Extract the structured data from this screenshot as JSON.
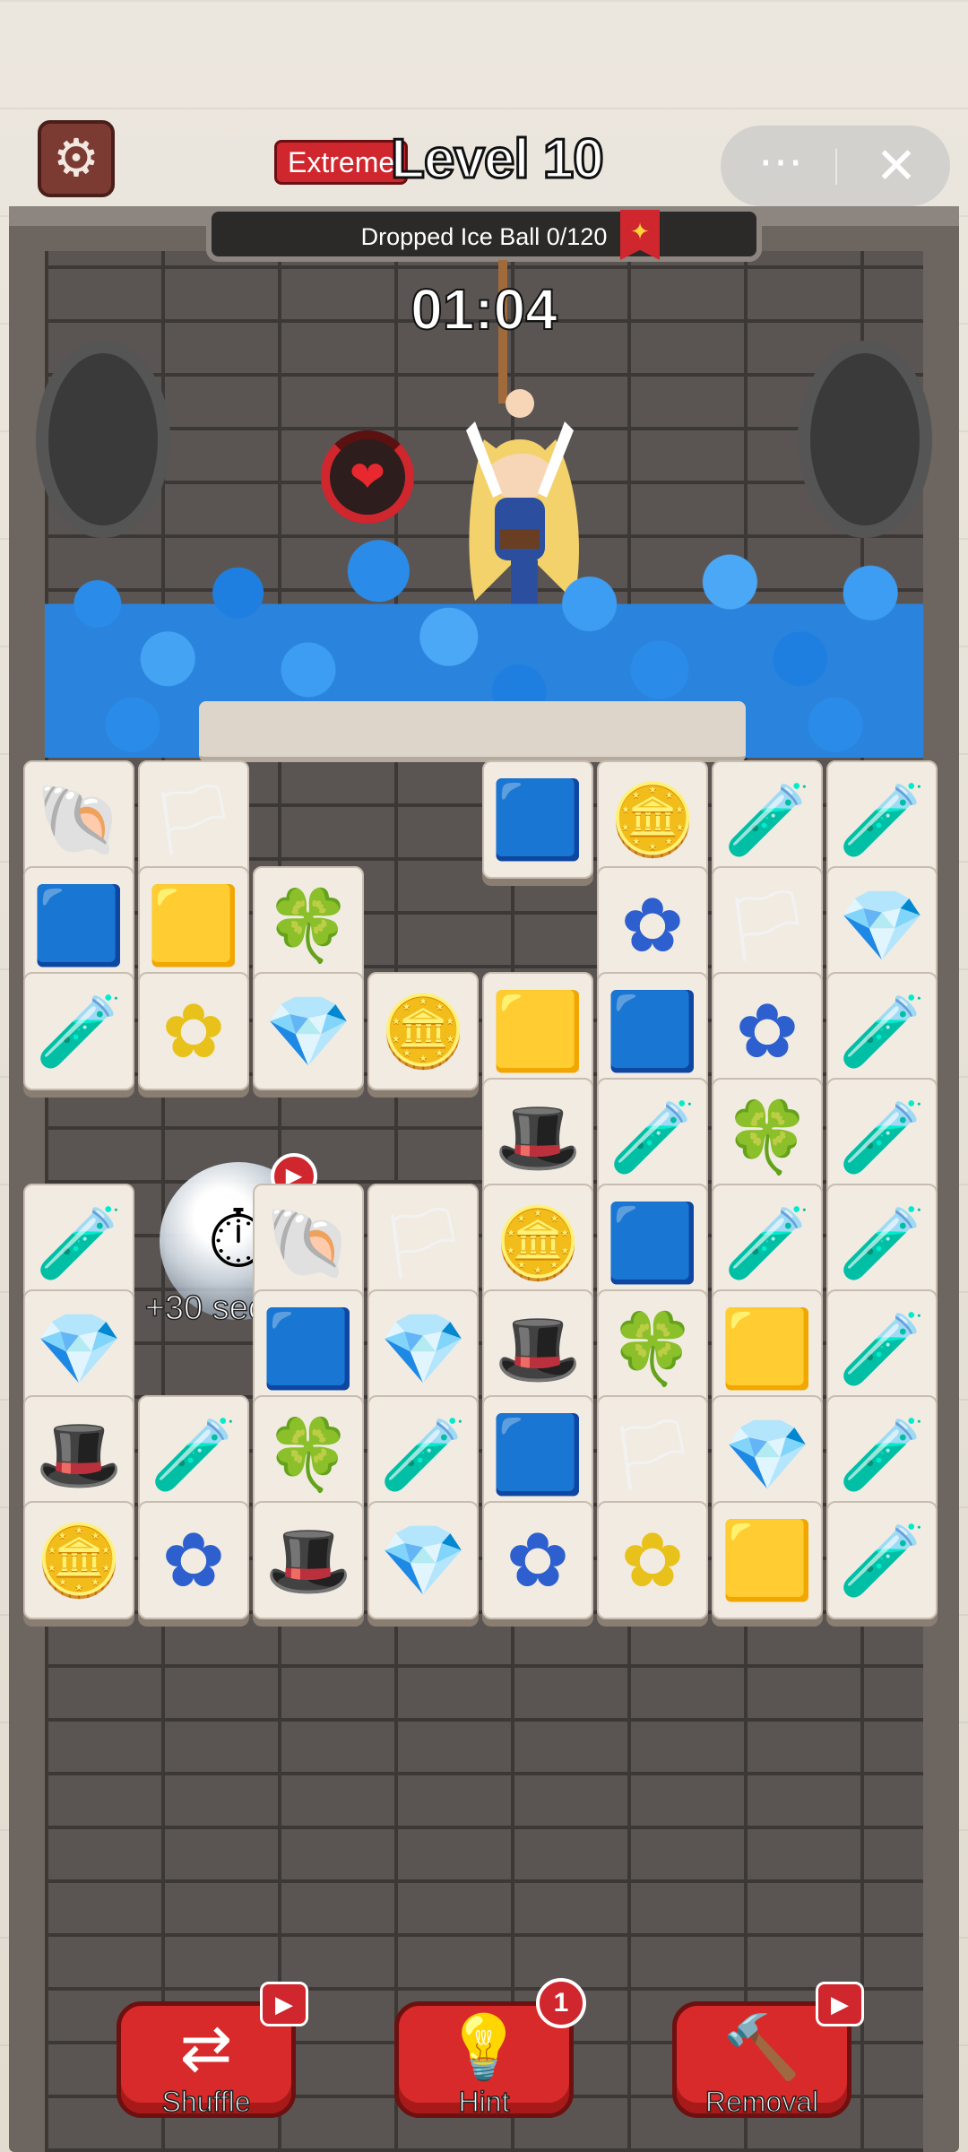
{
  "header": {
    "difficulty": "Extreme",
    "level": "Level 10",
    "more_icon": "⋯",
    "close_icon": "✕",
    "settings_icon": "⚙"
  },
  "goal": {
    "text": "Dropped Ice Ball 0/120",
    "ribbon_icon": "✦"
  },
  "timer": "01:04",
  "life": {
    "icon": "❤"
  },
  "board": {
    "tiles": [
      {
        "col": 0,
        "row": 0,
        "item": "shell"
      },
      {
        "col": 1,
        "row": 0,
        "item": "flag"
      },
      {
        "col": 4,
        "row": 0,
        "item": "banner-blue"
      },
      {
        "col": 5,
        "row": 0,
        "item": "coin"
      },
      {
        "col": 6,
        "row": 0,
        "item": "potion-red"
      },
      {
        "col": 7,
        "row": 0,
        "item": "potion-blue"
      },
      {
        "col": 0,
        "row": 1,
        "item": "banner-blue"
      },
      {
        "col": 1,
        "row": 1,
        "item": "banner-yellow"
      },
      {
        "col": 2,
        "row": 1,
        "item": "leaf-green"
      },
      {
        "col": 5,
        "row": 1,
        "item": "flower-blue"
      },
      {
        "col": 6,
        "row": 1,
        "item": "flag"
      },
      {
        "col": 7,
        "row": 1,
        "item": "crystal-red"
      },
      {
        "col": 0,
        "row": 2,
        "item": "potion-blue"
      },
      {
        "col": 1,
        "row": 2,
        "item": "flower-yellow"
      },
      {
        "col": 2,
        "row": 2,
        "item": "crystal-green"
      },
      {
        "col": 3,
        "row": 2,
        "item": "coin"
      },
      {
        "col": 4,
        "row": 2,
        "item": "banner-yellow"
      },
      {
        "col": 5,
        "row": 2,
        "item": "banner-blue"
      },
      {
        "col": 6,
        "row": 2,
        "item": "flower-blue"
      },
      {
        "col": 7,
        "row": 2,
        "item": "potion-blue"
      },
      {
        "col": 4,
        "row": 3,
        "item": "hat-green"
      },
      {
        "col": 5,
        "row": 3,
        "item": "potion-blue"
      },
      {
        "col": 6,
        "row": 3,
        "item": "leaf-green"
      },
      {
        "col": 7,
        "row": 3,
        "item": "potion-red"
      },
      {
        "col": 0,
        "row": 4,
        "item": "potion-red"
      },
      {
        "col": 2,
        "row": 4,
        "item": "shell"
      },
      {
        "col": 3,
        "row": 4,
        "item": "flag"
      },
      {
        "col": 4,
        "row": 4,
        "item": "coin"
      },
      {
        "col": 5,
        "row": 4,
        "item": "banner-blue"
      },
      {
        "col": 6,
        "row": 4,
        "item": "potion-blue"
      },
      {
        "col": 7,
        "row": 4,
        "item": "potion-red"
      },
      {
        "col": 0,
        "row": 5,
        "item": "crystal-green"
      },
      {
        "col": 2,
        "row": 5,
        "item": "banner-blue"
      },
      {
        "col": 3,
        "row": 5,
        "item": "crystal-green"
      },
      {
        "col": 4,
        "row": 5,
        "item": "hat-green"
      },
      {
        "col": 5,
        "row": 5,
        "item": "leaf-green"
      },
      {
        "col": 6,
        "row": 5,
        "item": "banner-yellow"
      },
      {
        "col": 7,
        "row": 5,
        "item": "potion-red"
      },
      {
        "col": 0,
        "row": 6,
        "item": "hat-green"
      },
      {
        "col": 1,
        "row": 6,
        "item": "potion-red"
      },
      {
        "col": 2,
        "row": 6,
        "item": "leaf-green"
      },
      {
        "col": 3,
        "row": 6,
        "item": "potion-blue"
      },
      {
        "col": 4,
        "row": 6,
        "item": "banner-blue"
      },
      {
        "col": 5,
        "row": 6,
        "item": "flag"
      },
      {
        "col": 6,
        "row": 6,
        "item": "crystal-red"
      },
      {
        "col": 7,
        "row": 6,
        "item": "potion-red"
      },
      {
        "col": 0,
        "row": 7,
        "item": "coin"
      },
      {
        "col": 1,
        "row": 7,
        "item": "flower-blue"
      },
      {
        "col": 2,
        "row": 7,
        "item": "hat-green"
      },
      {
        "col": 3,
        "row": 7,
        "item": "crystal-green"
      },
      {
        "col": 4,
        "row": 7,
        "item": "flower-blue"
      },
      {
        "col": 5,
        "row": 7,
        "item": "flower-yellow"
      },
      {
        "col": 6,
        "row": 7,
        "item": "banner-yellow"
      },
      {
        "col": 7,
        "row": 7,
        "item": "potion-red"
      }
    ]
  },
  "powerup": {
    "icon": "⏱",
    "badge_icon": "▶",
    "label": "+30 seconds"
  },
  "buttons": {
    "shuffle": {
      "label": "Shuffle",
      "icon": "⇄",
      "badge_icon": "▶"
    },
    "hint": {
      "label": "Hint",
      "icon": "💡",
      "count": "1"
    },
    "removal": {
      "label": "Removal",
      "icon": "🔨",
      "badge_icon": "▶"
    }
  },
  "colors": {
    "accent_red": "#d82a2a",
    "ice_blue": "#2a8ce8",
    "tile": "#f1ebe1"
  }
}
